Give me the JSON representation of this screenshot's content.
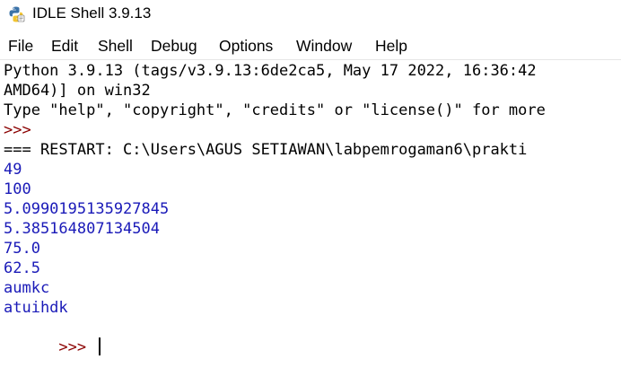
{
  "window": {
    "title": "IDLE Shell 3.9.13",
    "icon": "python-icon"
  },
  "menu": {
    "items": [
      "File",
      "Edit",
      "Shell",
      "Debug",
      "Options",
      "Window",
      "Help"
    ]
  },
  "shell": {
    "banner_line1": "Python 3.9.13 (tags/v3.9.13:6de2ca5, May 17 2022, 16:36:42",
    "banner_line2": "AMD64)] on win32",
    "banner_line3": "Type \"help\", \"copyright\", \"credits\" or \"license()\" for more",
    "prompt": ">>>",
    "restart_line": "=== RESTART: C:\\Users\\AGUS SETIAWAN\\labpemrogaman6\\prakti",
    "outputs": [
      "49",
      "100",
      "5.0990195135927845",
      "5.385164807134504",
      "75.0",
      "62.5",
      "aumkc",
      "atuihdk"
    ],
    "final_prompt": ">>> "
  },
  "colors": {
    "prompt": "#8b0000",
    "output": "#1a1ab8",
    "text": "#000000"
  }
}
